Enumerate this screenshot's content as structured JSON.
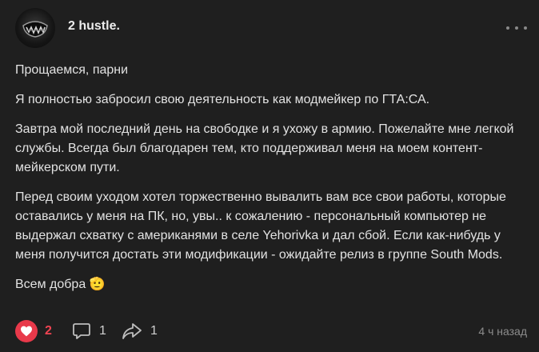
{
  "post": {
    "author": "2 hustle.",
    "paragraphs": [
      "Прощаемся, парни",
      "Я полностью забросил свою деятельность как модмейкер по ГТА:СА.",
      "Завтра мой последний день на свободке и я ухожу в армию. Пожелайте мне легкой службы. Всегда был благодарен тем, кто поддерживал меня на моем контент-мейкерском пути.",
      "Перед своим уходом хотел торжественно вывалить вам все свои работы, которые оставались у меня на ПК, но, увы.. к сожалению - персональный компьютер не выдержал схватку с американями в селе Yehorivka и дал сбой. Если как-нибудь у меня получится достать эти модификации - ожидайте релиз в группе South Mods.",
      "Всем добра 🫡"
    ],
    "likes": "2",
    "comments": "1",
    "shares": "1",
    "time": "4 ч назад"
  },
  "colors": {
    "background": "#1f1f1f",
    "like_accent": "#e8394a"
  },
  "icons": [
    "avatar",
    "more-icon",
    "heart-icon",
    "comment-icon",
    "share-icon"
  ]
}
